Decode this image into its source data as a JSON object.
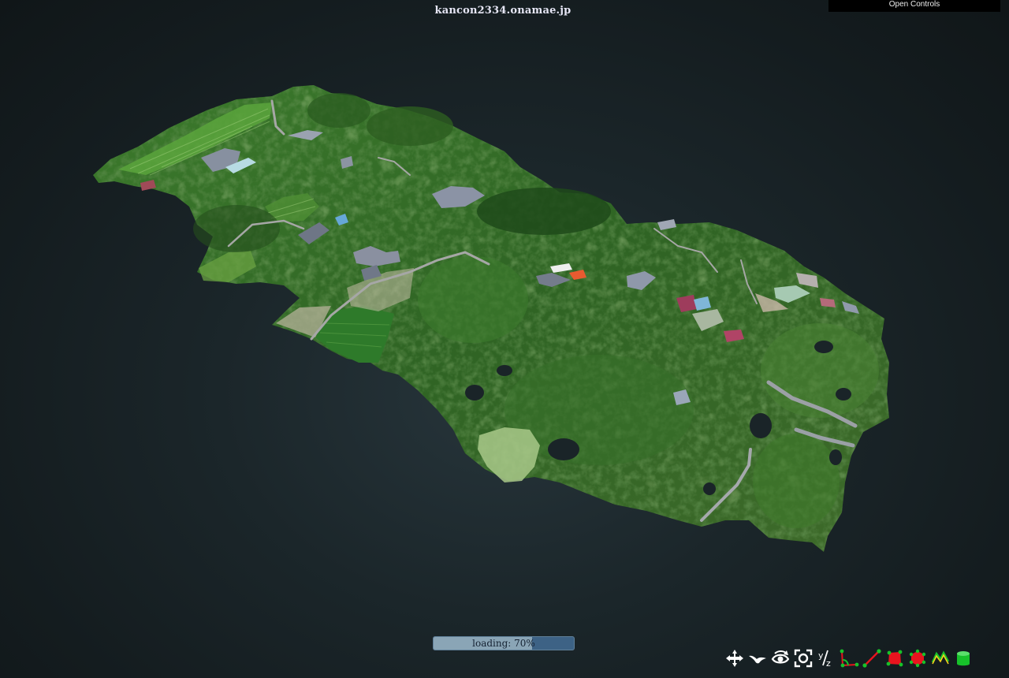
{
  "viewer": {
    "site_title": "kancon2334.onamae.jp",
    "open_controls_label": "Open Controls",
    "loading": {
      "label": "loading: 70%",
      "progress": 0.7
    }
  },
  "toolbar": {
    "tools": [
      {
        "icon": "navigation-cross-icon"
      },
      {
        "icon": "fly-bird-icon"
      },
      {
        "icon": "eye-orbit-icon"
      },
      {
        "icon": "focus-target-icon"
      },
      {
        "icon": "axis-yz-icon"
      },
      {
        "icon": "angle-measure-icon"
      },
      {
        "icon": "distance-measure-icon"
      },
      {
        "icon": "area-measure-icon"
      },
      {
        "icon": "volume-measure-icon"
      },
      {
        "icon": "height-profile-icon"
      },
      {
        "icon": "cylinder-volume-icon"
      }
    ],
    "colors": {
      "white": "#ffffff",
      "measure_red": "#e8141e",
      "measure_green": "#17c22a",
      "profile_yellow": "#f4d21c"
    }
  },
  "scene": {
    "background": "#182226",
    "cloud_colors": [
      "#2f5a22",
      "#3f7230",
      "#5a8e3c",
      "#7aab4f",
      "#6d7a8a",
      "#b8b6a8"
    ]
  }
}
